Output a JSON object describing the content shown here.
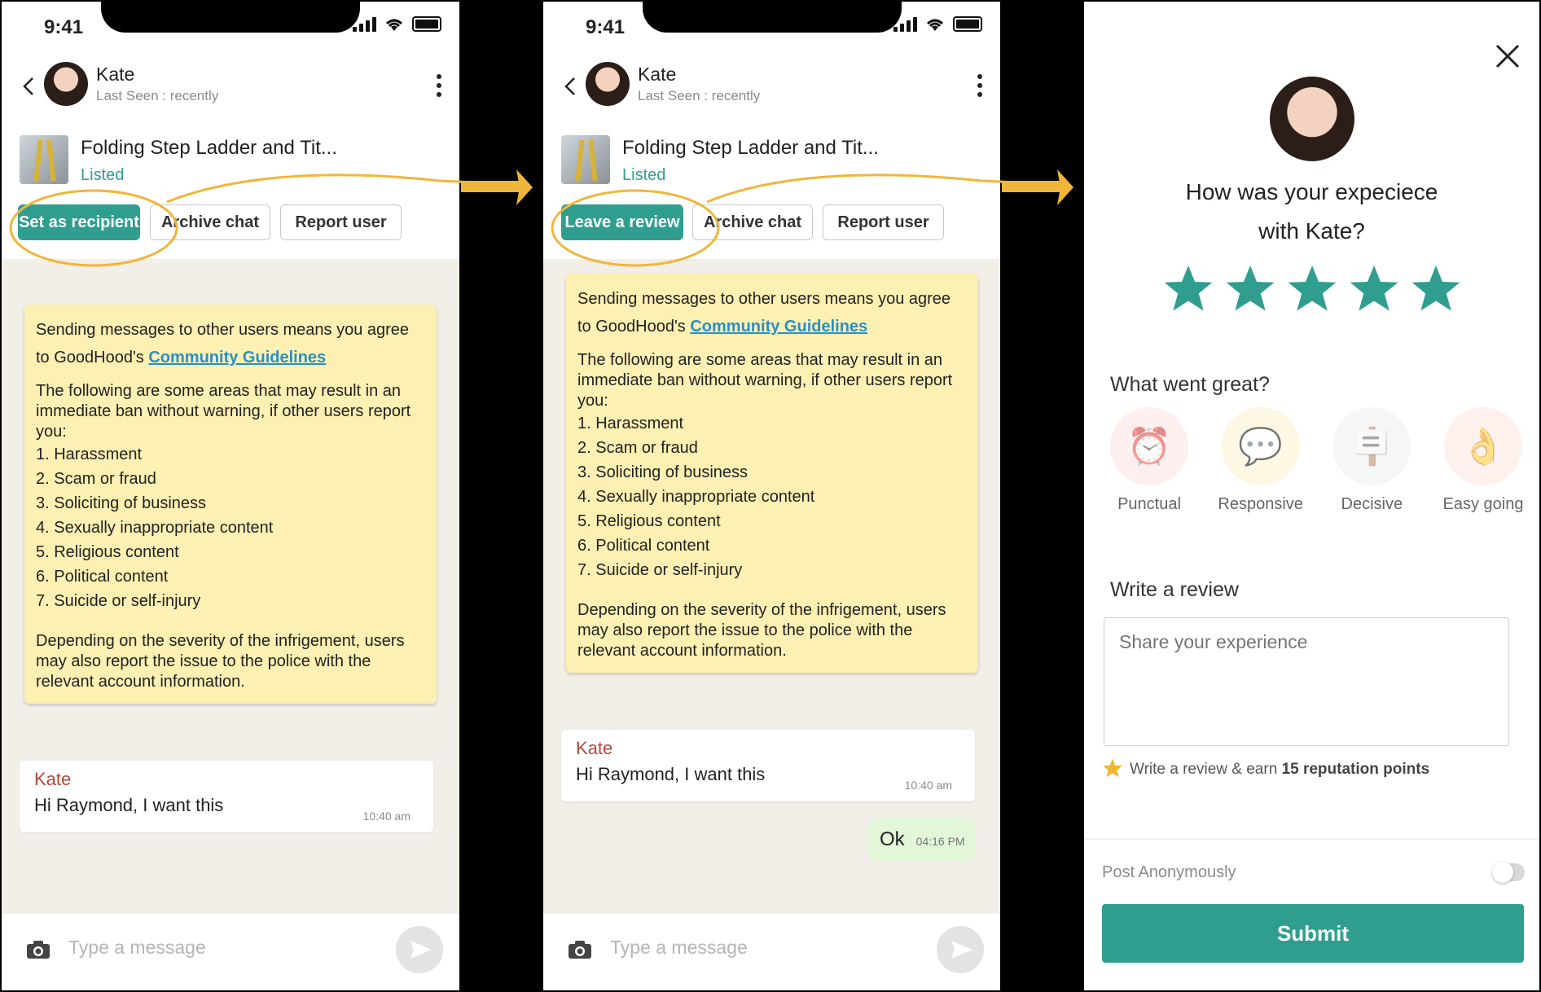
{
  "status_time": "9:41",
  "contact": {
    "name": "Kate",
    "last_seen": "Last Seen : recently"
  },
  "listing": {
    "title": "Folding Step Ladder and Tit...",
    "status": "Listed"
  },
  "buttons": {
    "set_recipient": "Set as recipient",
    "leave_review": "Leave a review",
    "archive": "Archive chat",
    "report": "Report user"
  },
  "notice": {
    "intro": "Sending messages to other users means you agree to GoodHood's",
    "link": "Community Guidelines",
    "warning": "The following are some areas that may result in an immediate ban without warning, if other users report you:",
    "items": [
      "1. Harassment",
      "2. Scam or fraud",
      "3. Soliciting of business",
      "4. Sexually inappropriate content",
      "5. Religious content",
      "6. Political content",
      "7. Suicide or self-injury"
    ],
    "footer": "Depending on the severity of the infrigement, users may also report the issue to the police with the relevant account information."
  },
  "message": {
    "sender": "Kate",
    "text": "Hi Raymond, I want this",
    "time": "10:40 am"
  },
  "reply": {
    "text": "Ok",
    "time": "04:16 PM"
  },
  "input_placeholder": "Type a message",
  "review": {
    "question_line1": "How was your expeciece",
    "question_line2": "with Kate?",
    "rating": 5,
    "star_color": "#2f9e8f",
    "went_great_label": "What went great?",
    "tags": [
      "Punctual",
      "Responsive",
      "Decisive",
      "Easy going"
    ],
    "write_label": "Write a review",
    "placeholder": "Share your experience",
    "earn_prefix": "Write a review & earn",
    "earn_points": "15 reputation points",
    "anonymous_label": "Post Anonymously",
    "submit_label": "Submit"
  },
  "colors": {
    "accent": "#2f9e8f",
    "highlight": "#f0b63a",
    "notice_bg": "#fdf0b3",
    "link": "#2a8fc6"
  }
}
